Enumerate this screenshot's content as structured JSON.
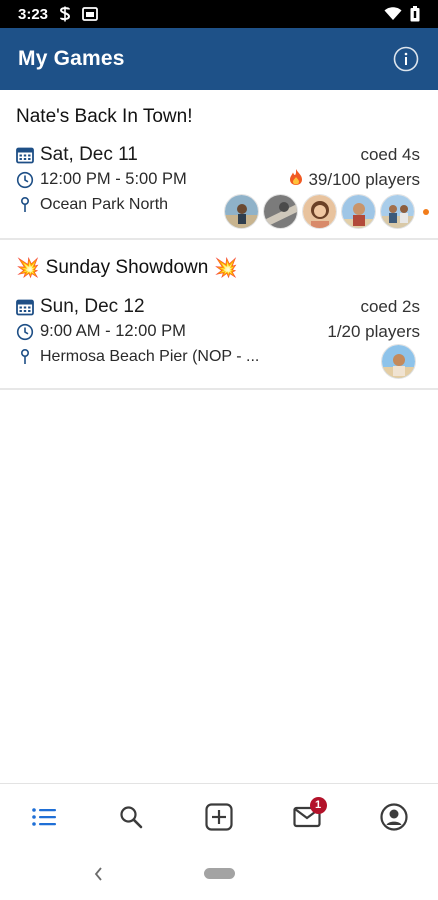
{
  "status_bar": {
    "time": "3:23"
  },
  "app_bar": {
    "title": "My Games"
  },
  "games": [
    {
      "title": "Nate's Back In Town!",
      "title_emoji": "",
      "date": "Sat, Dec 11",
      "time": "12:00 PM - 5:00 PM",
      "location": "Ocean Park North",
      "format": "coed 4s",
      "players": "39/100 players",
      "hot": true,
      "avatar_count": 5,
      "has_indicator_dot": true
    },
    {
      "title": "Sunday Showdown",
      "title_emoji": "💥",
      "date": "Sun, Dec 12",
      "time": "9:00 AM - 12:00 PM",
      "location": "Hermosa Beach Pier (NOP - ...",
      "format": "coed 2s",
      "players": "1/20 players",
      "hot": false,
      "avatar_count": 1,
      "has_indicator_dot": false
    }
  ],
  "bottom_nav": {
    "items": [
      "list-icon",
      "search-icon",
      "add-icon",
      "mail-icon",
      "profile-icon"
    ],
    "active": "list-icon",
    "mail_badge": "1"
  },
  "colors": {
    "app_bar": "#1e5188",
    "active_nav": "#1f6fd6",
    "badge": "#b3122a",
    "dot": "#f27c1a"
  }
}
